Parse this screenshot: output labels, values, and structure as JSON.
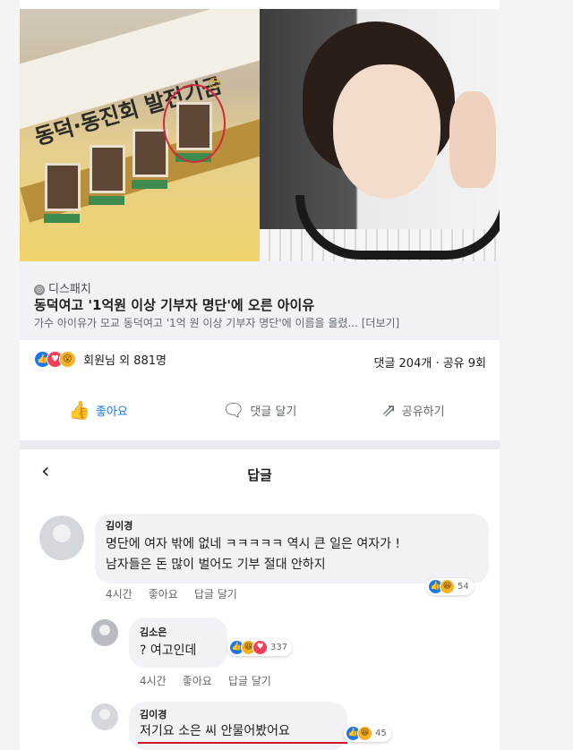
{
  "hero": {
    "banner_text": "동덕·동진회 발전기금"
  },
  "preview": {
    "source": "디스패치",
    "title": "동덕여고 '1억원 이상 기부자 명단'에 오른 아이유",
    "description": "가수 아이유가 모교 동덕여고 '1억 원 이상 기부자 명단'에 이름을 올렸... [더보기]"
  },
  "stats": {
    "reactors": "회원님 외 881명",
    "counts": "댓글 204개 · 공유 9회"
  },
  "actions": {
    "like": "좋아요",
    "comment": "댓글 달기",
    "share": "공유하기"
  },
  "replies": {
    "title": "답글"
  },
  "comments": [
    {
      "name": "김이경",
      "lines": [
        "명단에 여자 밖에 없네 ㅋㅋㅋㅋㅋ 역시 큰 일은 여자가 !",
        "남자들은 돈 많이 벌어도 기부 절대 안하지"
      ],
      "time": "4시간",
      "like": "좋아요",
      "reply": "답글 달기",
      "reaction_count": "54"
    },
    {
      "name": "김소은",
      "lines": [
        "? 여고인데"
      ],
      "time": "4시간",
      "like": "좋아요",
      "reply": "답글 달기",
      "reaction_count": "337"
    },
    {
      "name": "김이경",
      "lines": [
        "저기요 소은 씨 안물어봤어요"
      ],
      "reaction_count": "45"
    }
  ],
  "colors": {
    "facebook_blue": "#1877f2",
    "love_red": "#f33e58",
    "haha_yellow": "#f7b125",
    "underline_red": "#d0142d"
  },
  "icons": {
    "like": "thumbs-up-icon",
    "comment": "speech-bubble-icon",
    "share": "share-arrow-icon",
    "back": "chevron-left-icon"
  }
}
